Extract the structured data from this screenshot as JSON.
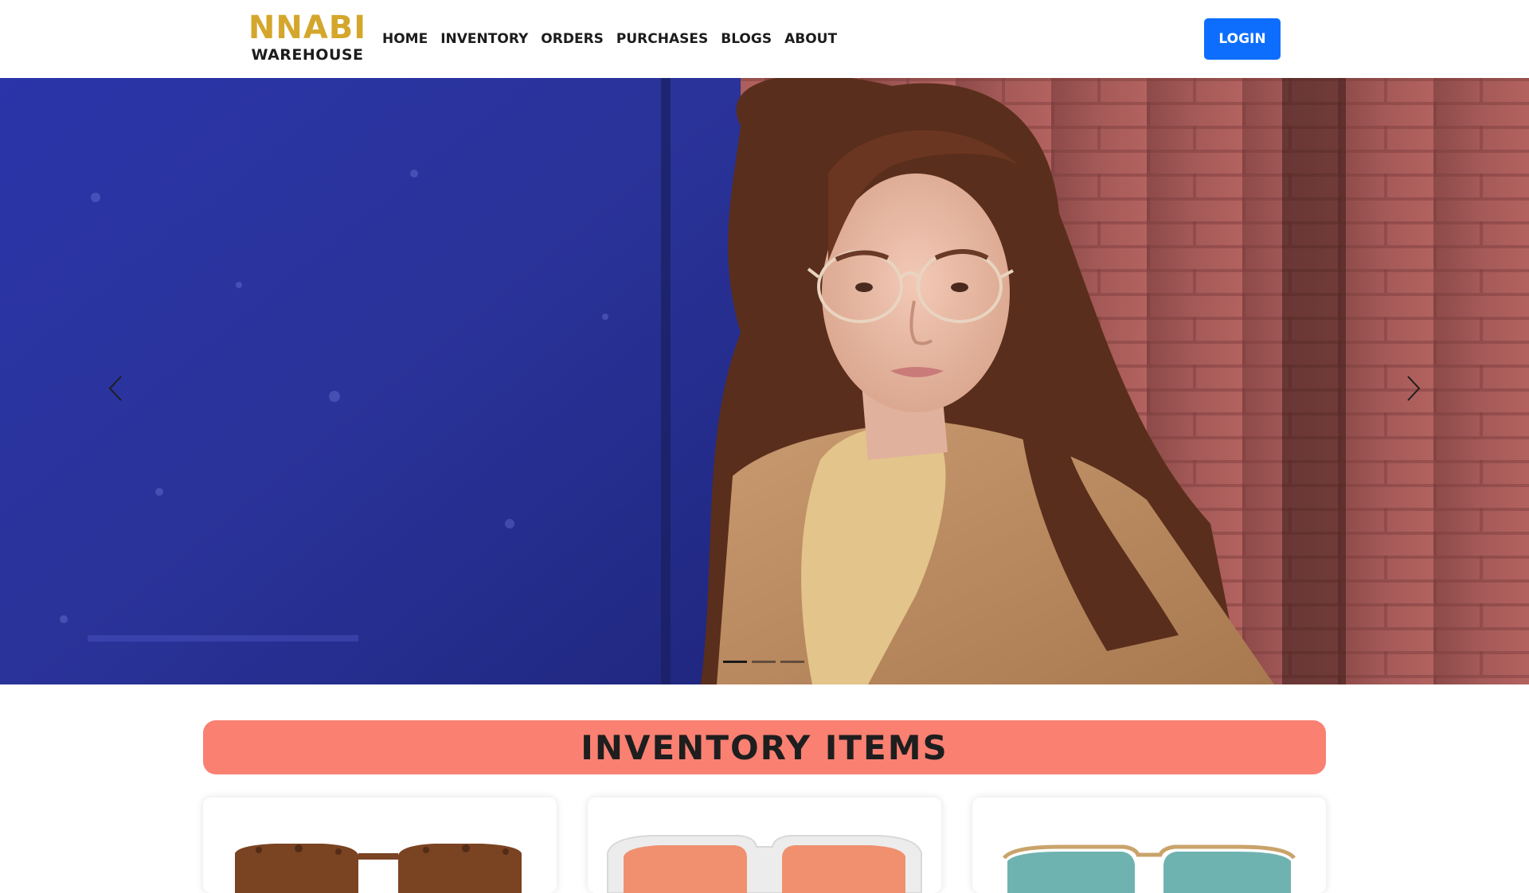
{
  "brand": {
    "line1": "NNABI",
    "line2": "WAREHOUSE"
  },
  "nav": {
    "links": [
      "HOME",
      "INVENTORY",
      "ORDERS",
      "PURCHASES",
      "BLOGS",
      "ABOUT"
    ],
    "login_label": "LOGIN"
  },
  "hero": {
    "slide_count": 3,
    "active_slide": 1,
    "prev_icon": "chevron-left-icon",
    "next_icon": "chevron-right-icon"
  },
  "inventory": {
    "title": "INVENTORY ITEMS",
    "items": [
      {
        "image": "tortoise-shell-glasses"
      },
      {
        "image": "clear-frame-orange-lens-glasses"
      },
      {
        "image": "gold-frame-teal-lens-glasses"
      }
    ]
  },
  "colors": {
    "brand_gold": "#d4a72c",
    "login_blue": "#0d6efd",
    "section_salmon": "#fa8072"
  }
}
